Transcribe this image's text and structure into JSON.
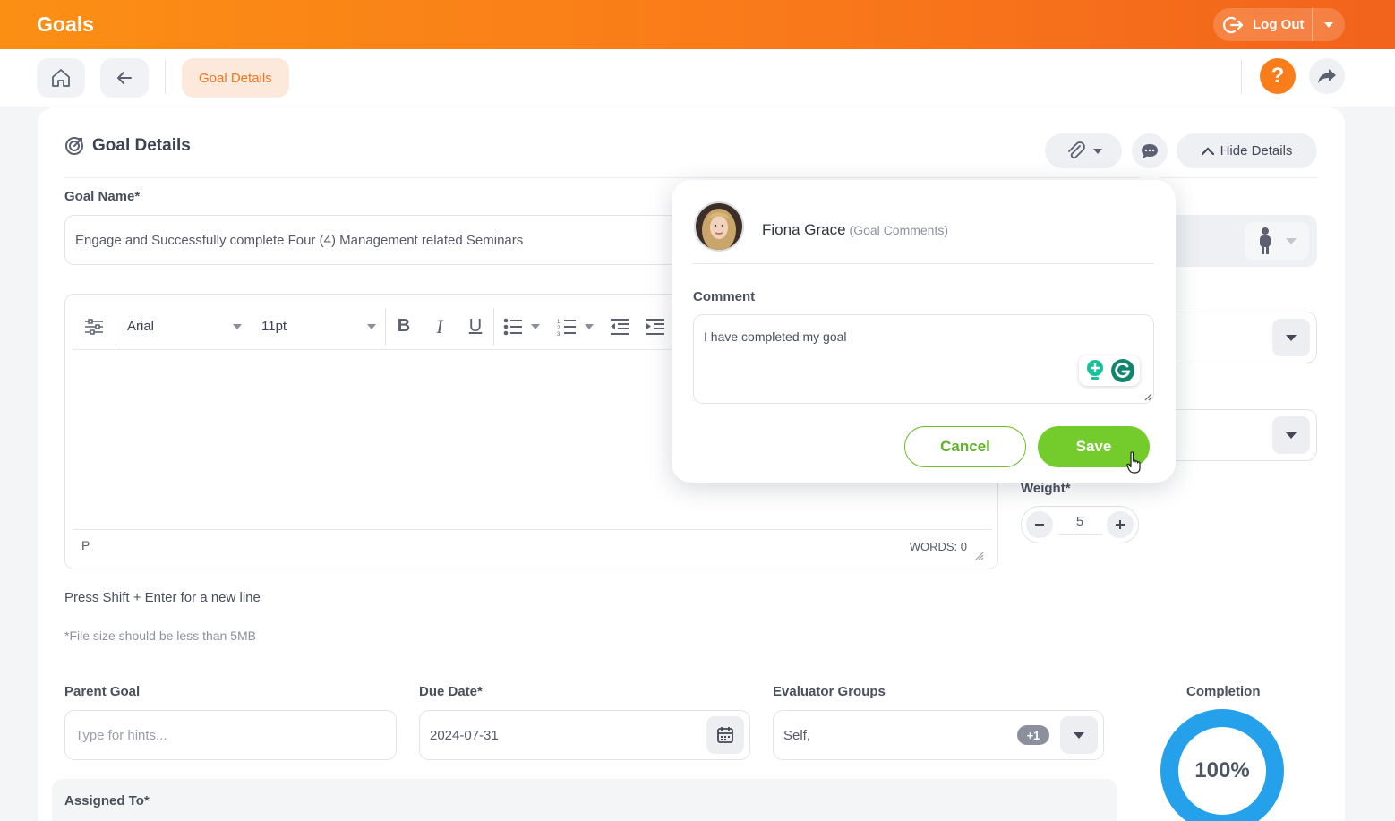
{
  "app": {
    "title": "Goals",
    "logout_label": "Log Out"
  },
  "nav": {
    "breadcrumb": "Goal Details"
  },
  "section": {
    "title": "Goal Details",
    "hide_details_label": "Hide Details"
  },
  "goal_name": {
    "label": "Goal Name*",
    "value": "Engage and Successfully complete Four (4) Management related Seminars"
  },
  "editor": {
    "font": "Arial",
    "size": "11pt",
    "status_path": "P",
    "word_count": "WORDS: 0",
    "hint": "Press Shift + Enter for a new line",
    "file_note": "*File size should be less than 5MB"
  },
  "weight": {
    "label": "Weight*",
    "value": "5"
  },
  "parent_goal": {
    "label": "Parent Goal",
    "placeholder": "Type for hints..."
  },
  "due_date": {
    "label": "Due Date*",
    "value": "2024-07-31"
  },
  "evaluator_groups": {
    "label": "Evaluator Groups",
    "value": "Self,",
    "extra_badge": "+1"
  },
  "completion": {
    "label": "Completion",
    "value": "100%",
    "percent": 100
  },
  "assigned_to": {
    "label": "Assigned To*"
  },
  "comment_popover": {
    "user": "Fiona Grace",
    "context": "(Goal Comments)",
    "comment_label": "Comment",
    "comment_text": "I have completed my goal",
    "cancel_label": "Cancel",
    "save_label": "Save"
  },
  "colors": {
    "brand": "#f97d1b",
    "save": "#74cc2c",
    "completion": "#24a1ea"
  }
}
